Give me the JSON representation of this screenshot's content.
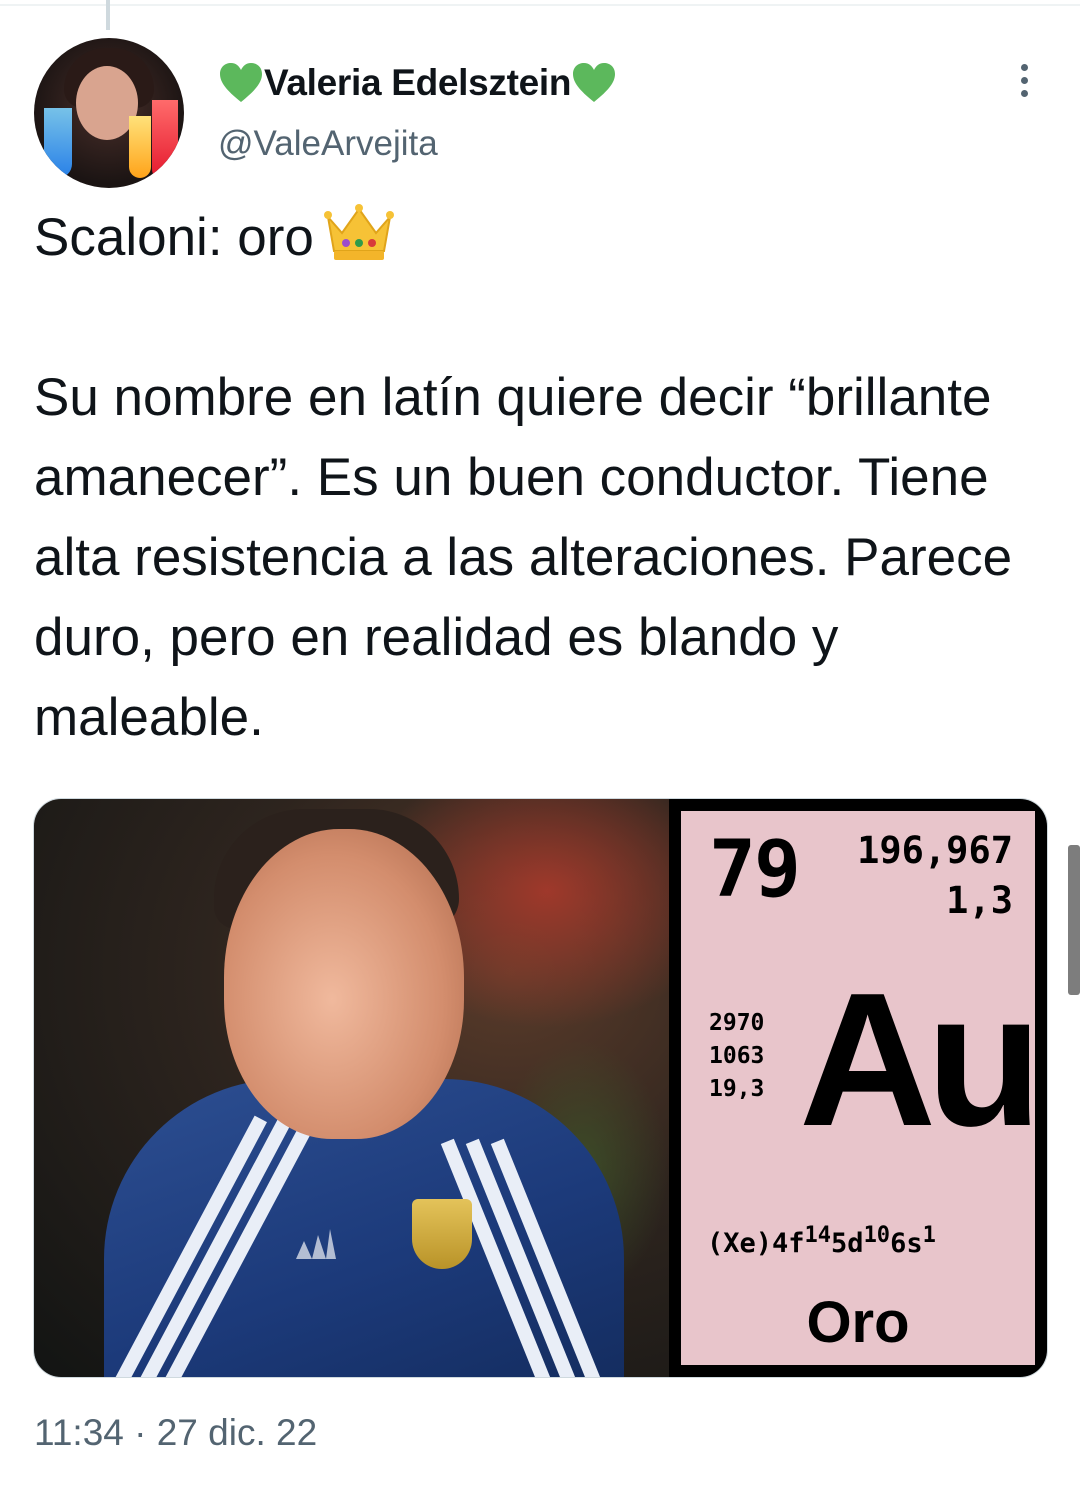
{
  "tweet": {
    "author": {
      "display_name": "Valeria Edelsztein",
      "name_emoji": "green-heart",
      "handle": "@ValeArvejita"
    },
    "text": {
      "line1": "Scaloni: oro",
      "line1_emoji": "crown",
      "paragraph2": "Su nombre en latín quiere decir “brillante amanecer”. Es un buen conductor. Tiene alta resistencia a las alteraciones. Parece duro, pero en realidad es blando y maleable."
    },
    "timestamp": "11:34 · 27 dic. 22"
  },
  "element_card": {
    "atomic_number": "79",
    "atomic_mass": "196,967",
    "electronegativity": "1,3",
    "boiling_point": "2970",
    "melting_point": "1063",
    "density": "19,3",
    "symbol": "Au",
    "config_core": "(Xe)",
    "config_1": "4f",
    "config_1_exp": "14",
    "config_2": "5d",
    "config_2_exp": "10",
    "config_3": "6s",
    "config_3_exp": "1",
    "name": "Oro",
    "background_color": "#e8c5cb"
  },
  "colors": {
    "text_primary": "#0f1419",
    "text_secondary": "#536471",
    "emoji_heart": "#4caf50"
  }
}
